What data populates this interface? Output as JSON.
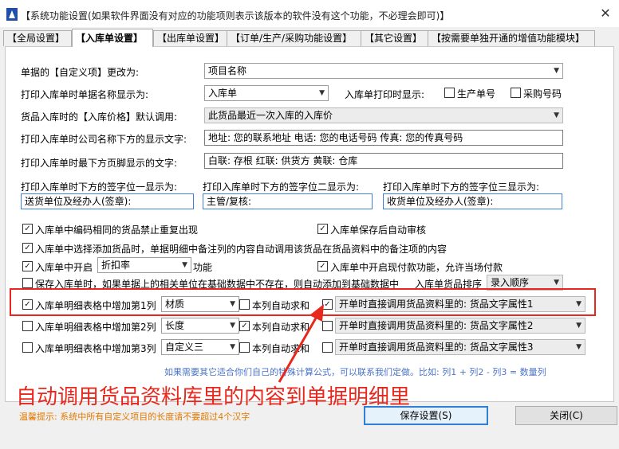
{
  "window": {
    "title": "【系统功能设置(如果软件界面没有对应的功能项则表示该版本的软件没有这个功能，不必理会即可)】",
    "close": "✕"
  },
  "tabs": [
    {
      "label": "【全局设置】",
      "active": false
    },
    {
      "label": "【入库单设置】",
      "active": true
    },
    {
      "label": "【出库单设置】",
      "active": false
    },
    {
      "label": "【订单/生产/采购功能设置】",
      "active": false
    },
    {
      "label": "【其它设置】",
      "active": false
    },
    {
      "label": "【按需要单独开通的增值功能模块】",
      "active": false
    }
  ],
  "form": {
    "custom_item_label": "单据的【自定义项】更改为:",
    "custom_item_value": "项目名称",
    "print_name_label": "打印入库单时单据名称显示为:",
    "print_name_value": "入库单",
    "print_show_label": "入库单打印时显示:",
    "cb_prod_no": "生产单号",
    "cb_purchase_no": "采购号码",
    "price_label": "货品入库时的【入库价格】默认调用:",
    "price_value": "此货品最近一次入库的入库价",
    "company_text_label": "打印入库单时公司名称下方的显示文字:",
    "company_text_value": "地址: 您的联系地址 电话: 您的电话号码 传真: 您的传真号码",
    "footer_text_label": "打印入库单时最下方页脚显示的文字:",
    "footer_text_value": "白联: 存根   红联: 供货方   黄联: 仓库",
    "sign1_label": "打印入库单时下方的签字位一显示为:",
    "sign1_value": "送货单位及经办人(签章):",
    "sign2_label": "打印入库单时下方的签字位二显示为:",
    "sign2_value": "主管/复核:",
    "sign3_label": "打印入库单时下方的签字位三显示为:",
    "sign3_value": "收货单位及经办人(签章):"
  },
  "options": {
    "opt1": "入库单中编码相同的货品禁止重复出现",
    "opt2": "入库单保存后自动审核",
    "opt3": "入库单中选择添加货品时，单据明细中备注列的内容自动调用该货品在货品资料中的备注项的内容",
    "opt4_prefix": "入库单中开启",
    "opt4_combo": "折扣率",
    "opt4_suffix": "功能",
    "opt5": "入库单中开启现付款功能，允许当场付款",
    "opt6": "保存入库单时，如果单据上的相关单位在基础数据中不存在，则自动添加到基础数据中",
    "sort_label": "入库单货品排序",
    "sort_value": "录入顺序"
  },
  "columns": [
    {
      "label": "入库单明细表格中增加第1列",
      "combo": "材质",
      "sum_label": "本列自动求和",
      "sum_checked": false,
      "link_checked": true,
      "link_value": "开单时直接调用货品资料里的: 货品文字属性1"
    },
    {
      "label": "入库单明细表格中增加第2列",
      "combo": "长度",
      "sum_label": "本列自动求和",
      "sum_checked": true,
      "link_checked": false,
      "link_value": "开单时直接调用货品资料里的: 货品文字属性2"
    },
    {
      "label": "入库单明细表格中增加第3列",
      "combo": "自定义三",
      "sum_label": "本列自动求和",
      "sum_checked": false,
      "link_checked": false,
      "link_value": "开单时直接调用货品资料里的: 货品文字属性3"
    }
  ],
  "formula_note": "如果需要其它适合你们自己的特殊计算公式，可以联系我们定做。比如: 列1 + 列2 - 列3 = 数量列",
  "annotation": "自动调用货品资料库里的内容到单据明细里",
  "hint": "温馨提示: 系统中所有自定义项目的长度请不要超过4个汉字",
  "buttons": {
    "save": "保存设置(S)",
    "close": "关闭(C)"
  },
  "colors": {
    "annotation_red": "#e8271d",
    "hint_orange": "#e27a00",
    "note_blue": "#4b74c9",
    "primary_border": "#2f7fd6"
  }
}
